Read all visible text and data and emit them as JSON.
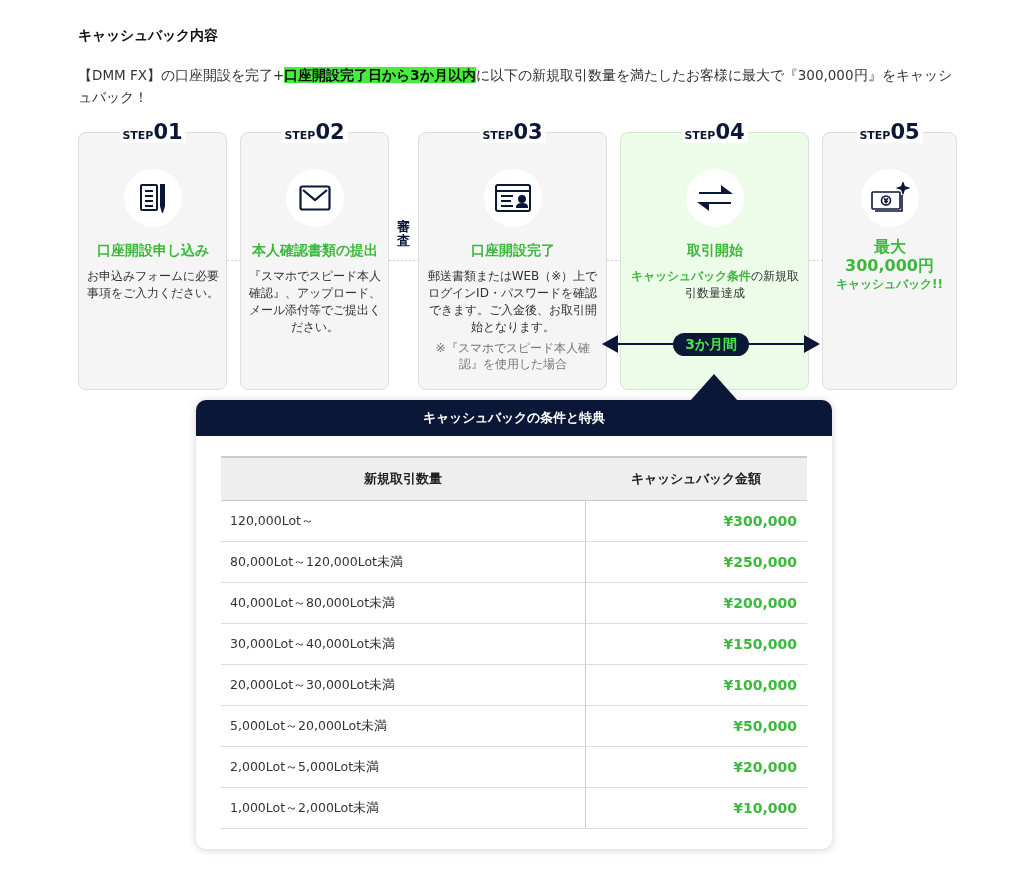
{
  "heading": "キャッシュバック内容",
  "intro": "【DMM FX】の口座開設を完了+**口座開設完了日から3か月以内**に以下の新規取引数量を満たしたお客様に最大で『300,000円』をキャッシュバック！",
  "steps": [
    {
      "kind": "text",
      "step_label": "STEP",
      "number": "01",
      "title": "口座開設申し込み",
      "description": "お申込みフォームに必要事項をご入力ください。",
      "highlighted": false
    },
    {
      "kind": "text",
      "step_label": "STEP",
      "number": "02",
      "title": "本人確認書類の提出",
      "description": "『スマホでスピード本人確認』、アップロード、メール添付等でご提出ください。",
      "highlighted": false
    },
    {
      "kind": "text",
      "step_label": "STEP",
      "number": "03",
      "gap_label": "審査",
      "title": "口座開設完了",
      "description": "郵送書類またはWEB（※）上でログインID・パスワードを確認できます。ご入金後、お取引開始となります。",
      "note": "※『スマホでスピード本人確認』を使用した場合",
      "highlighted": false
    },
    {
      "kind": "text",
      "step_label": "STEP",
      "number": "04",
      "title": "取引開始",
      "description": "**キャッシュバック条件**の新規取引数量達成",
      "highlighted": true
    },
    {
      "kind": "reward",
      "step_label": "STEP",
      "number": "05",
      "title": "最大",
      "amount": "300,000円",
      "caption": "キャッシュバック!!",
      "highlighted": false
    }
  ],
  "period": {
    "label": "3か月間"
  },
  "table": {
    "title": "キャッシュバックの条件と特典",
    "columns": [
      "新規取引数量",
      "キャッシュバック金額"
    ],
    "rows": [
      {
        "lots": "120,000Lot～",
        "amount": "¥300,000"
      },
      {
        "lots": "80,000Lot～120,000Lot未満",
        "amount": "¥250,000"
      },
      {
        "lots": "40,000Lot～80,000Lot未満",
        "amount": "¥200,000"
      },
      {
        "lots": "30,000Lot～40,000Lot未満",
        "amount": "¥150,000"
      },
      {
        "lots": "20,000Lot～30,000Lot未満",
        "amount": "¥100,000"
      },
      {
        "lots": "5,000Lot～20,000Lot未満",
        "amount": "¥50,000"
      },
      {
        "lots": "2,000Lot～5,000Lot未満",
        "amount": "¥20,000"
      },
      {
        "lots": "1,000Lot～2,000Lot未満",
        "amount": "¥10,000"
      }
    ]
  }
}
